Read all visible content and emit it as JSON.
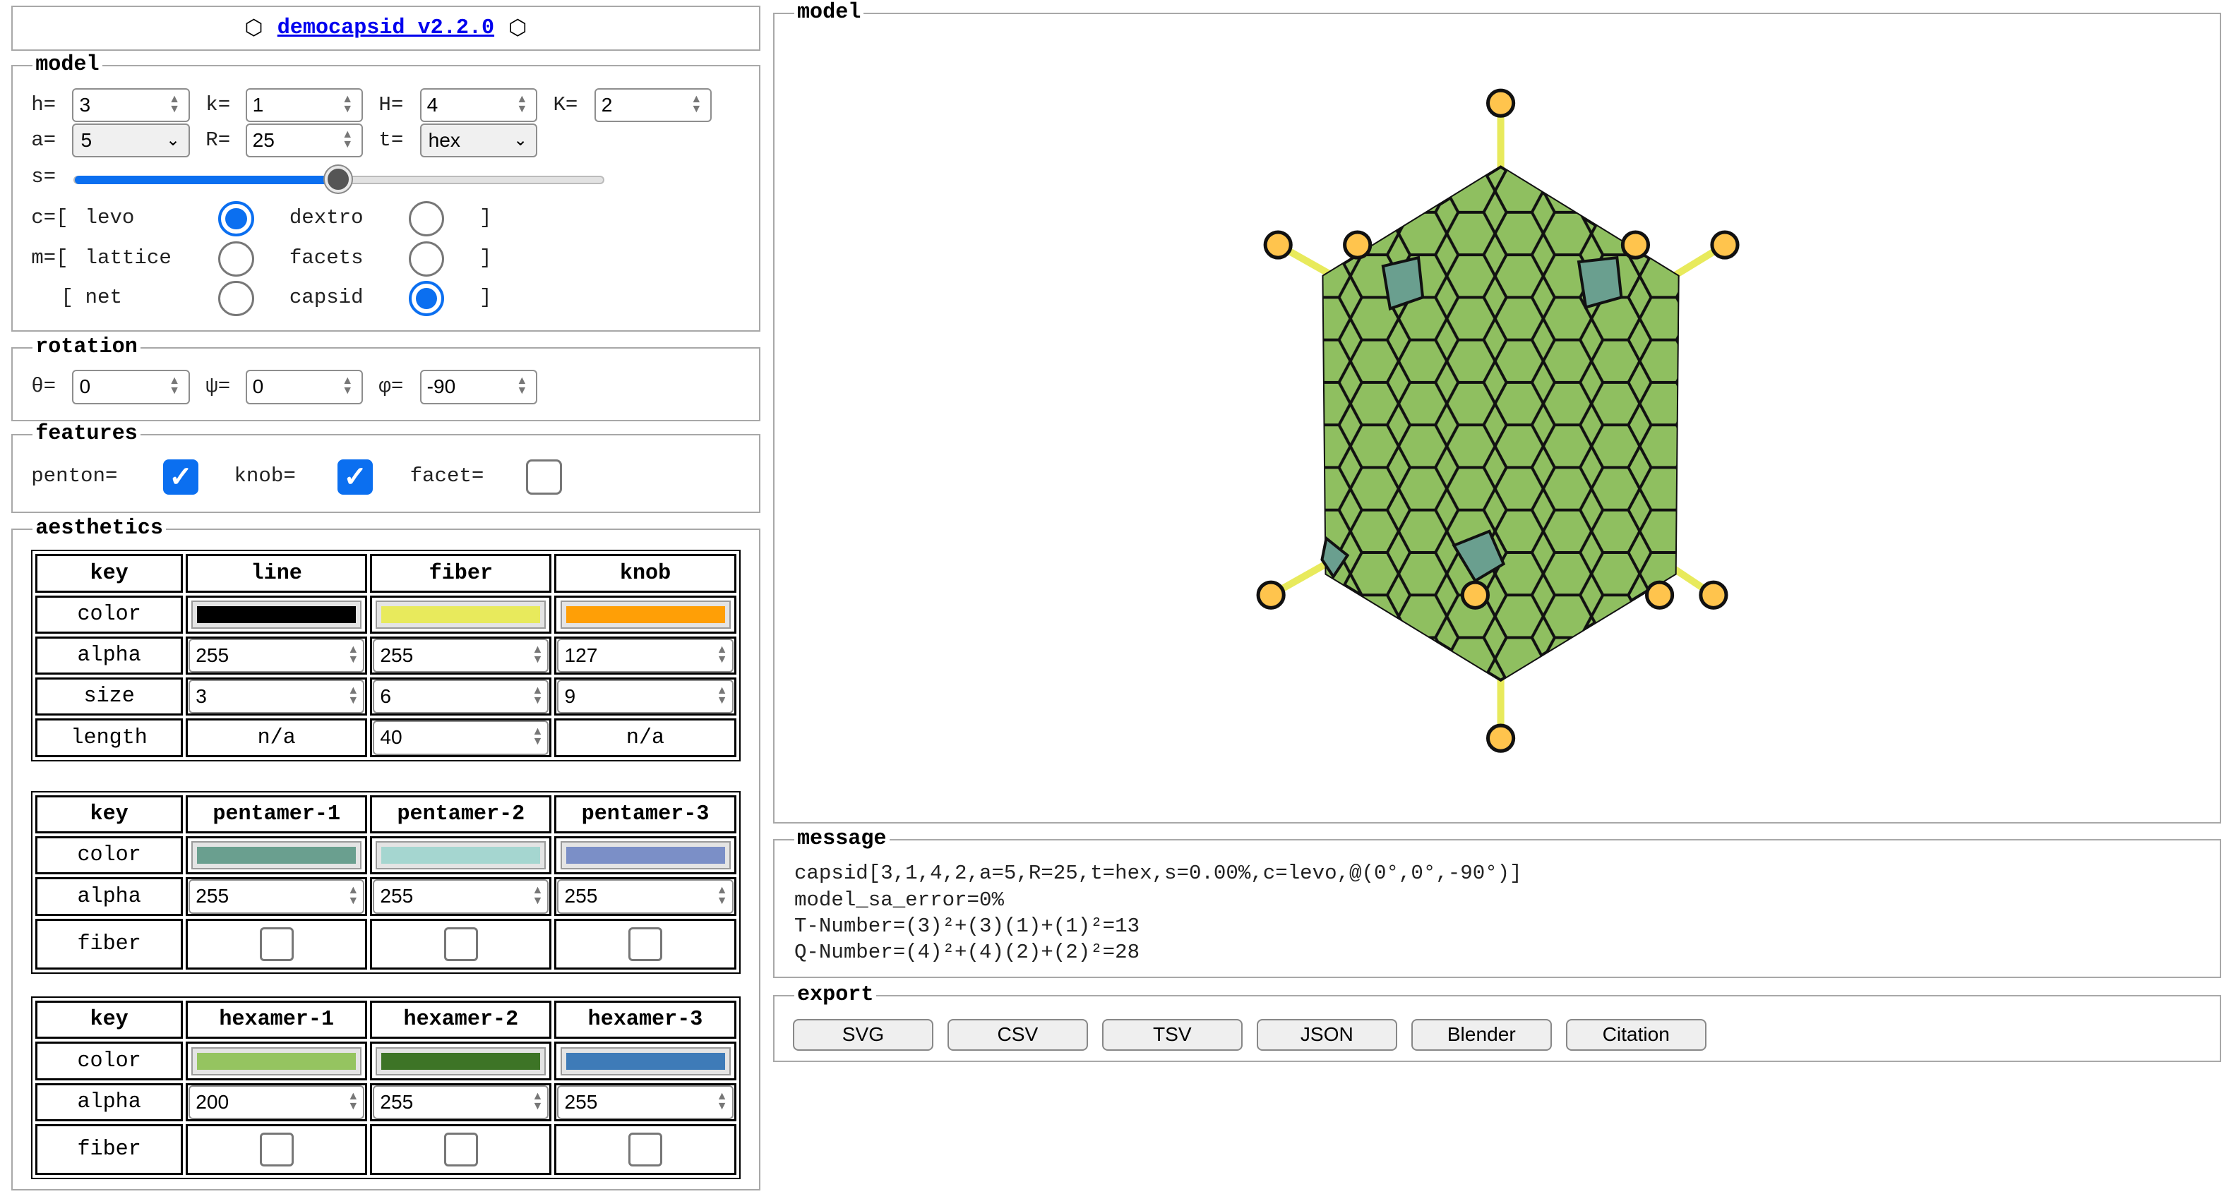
{
  "header": {
    "icon_left": "⬡",
    "icon_right": "⬡",
    "app_link": "democapsid v2.2.0"
  },
  "model": {
    "legend": "model",
    "h_label": "h=",
    "h": "3",
    "k_label": "k=",
    "k": "1",
    "H_label": "H=",
    "H": "4",
    "K_label": "K=",
    "K": "2",
    "a_label": "a=",
    "a": "5",
    "R_label": "R=",
    "R": "25",
    "t_label": "t=",
    "t": "hex",
    "s_label": "s=",
    "s_value_fraction": 0.5,
    "c_label": "c=[",
    "c_opt1": "levo",
    "c_opt2": "dextro",
    "c_selected": "levo",
    "m_label": "m=[",
    "m_opt1": "lattice",
    "m_opt2": "facets",
    "m_opt3": "net",
    "m_opt4": "capsid",
    "m_selected": "capsid",
    "m_row2_open": "[",
    "close_bracket": "]"
  },
  "rotation": {
    "legend": "rotation",
    "theta_label": "θ=",
    "theta": "0",
    "psi_label": "ψ=",
    "psi": "0",
    "phi_label": "φ=",
    "phi": "-90"
  },
  "features": {
    "legend": "features",
    "penton_label": "penton=",
    "penton": true,
    "knob_label": "knob=",
    "knob": true,
    "facet_label": "facet=",
    "facet": false
  },
  "aesthetics": {
    "legend": "aesthetics",
    "table1": {
      "headers": [
        "key",
        "line",
        "fiber",
        "knob"
      ],
      "color_label": "color",
      "colors": [
        "#000000",
        "#e8ea5c",
        "#ff9f06"
      ],
      "alpha_label": "alpha",
      "alpha": [
        "255",
        "255",
        "127"
      ],
      "size_label": "size",
      "size": [
        "3",
        "6",
        "9"
      ],
      "length_label": "length",
      "length": [
        "n/a",
        "40",
        "n/a"
      ]
    },
    "table2": {
      "headers": [
        "key",
        "pentamer-1",
        "pentamer-2",
        "pentamer-3"
      ],
      "color_label": "color",
      "colors": [
        "#6a9f8f",
        "#a5d6d0",
        "#7b8fc7"
      ],
      "alpha_label": "alpha",
      "alpha": [
        "255",
        "255",
        "255"
      ],
      "fiber_label": "fiber"
    },
    "table3": {
      "headers": [
        "key",
        "hexamer-1",
        "hexamer-2",
        "hexamer-3"
      ],
      "color_label": "color",
      "colors": [
        "#95c460",
        "#3d7426",
        "#3e7bb8"
      ],
      "alpha_label": "alpha",
      "alpha": [
        "200",
        "255",
        "255"
      ],
      "fiber_label": "fiber"
    }
  },
  "viewer": {
    "legend": "model"
  },
  "message": {
    "legend": "message",
    "line1": "capsid[3,1,4,2,a=5,R=25,t=hex,s=0.00%,c=levo,@(0°,0°,-90°)]",
    "line2": "model_sa_error=0%",
    "line3": "T-Number=(3)²+(3)(1)+(1)²=13",
    "line4": "Q-Number=(4)²+(4)(2)+(2)²=28"
  },
  "export": {
    "legend": "export",
    "buttons": [
      "SVG",
      "CSV",
      "TSV",
      "JSON",
      "Blender",
      "Citation"
    ]
  }
}
